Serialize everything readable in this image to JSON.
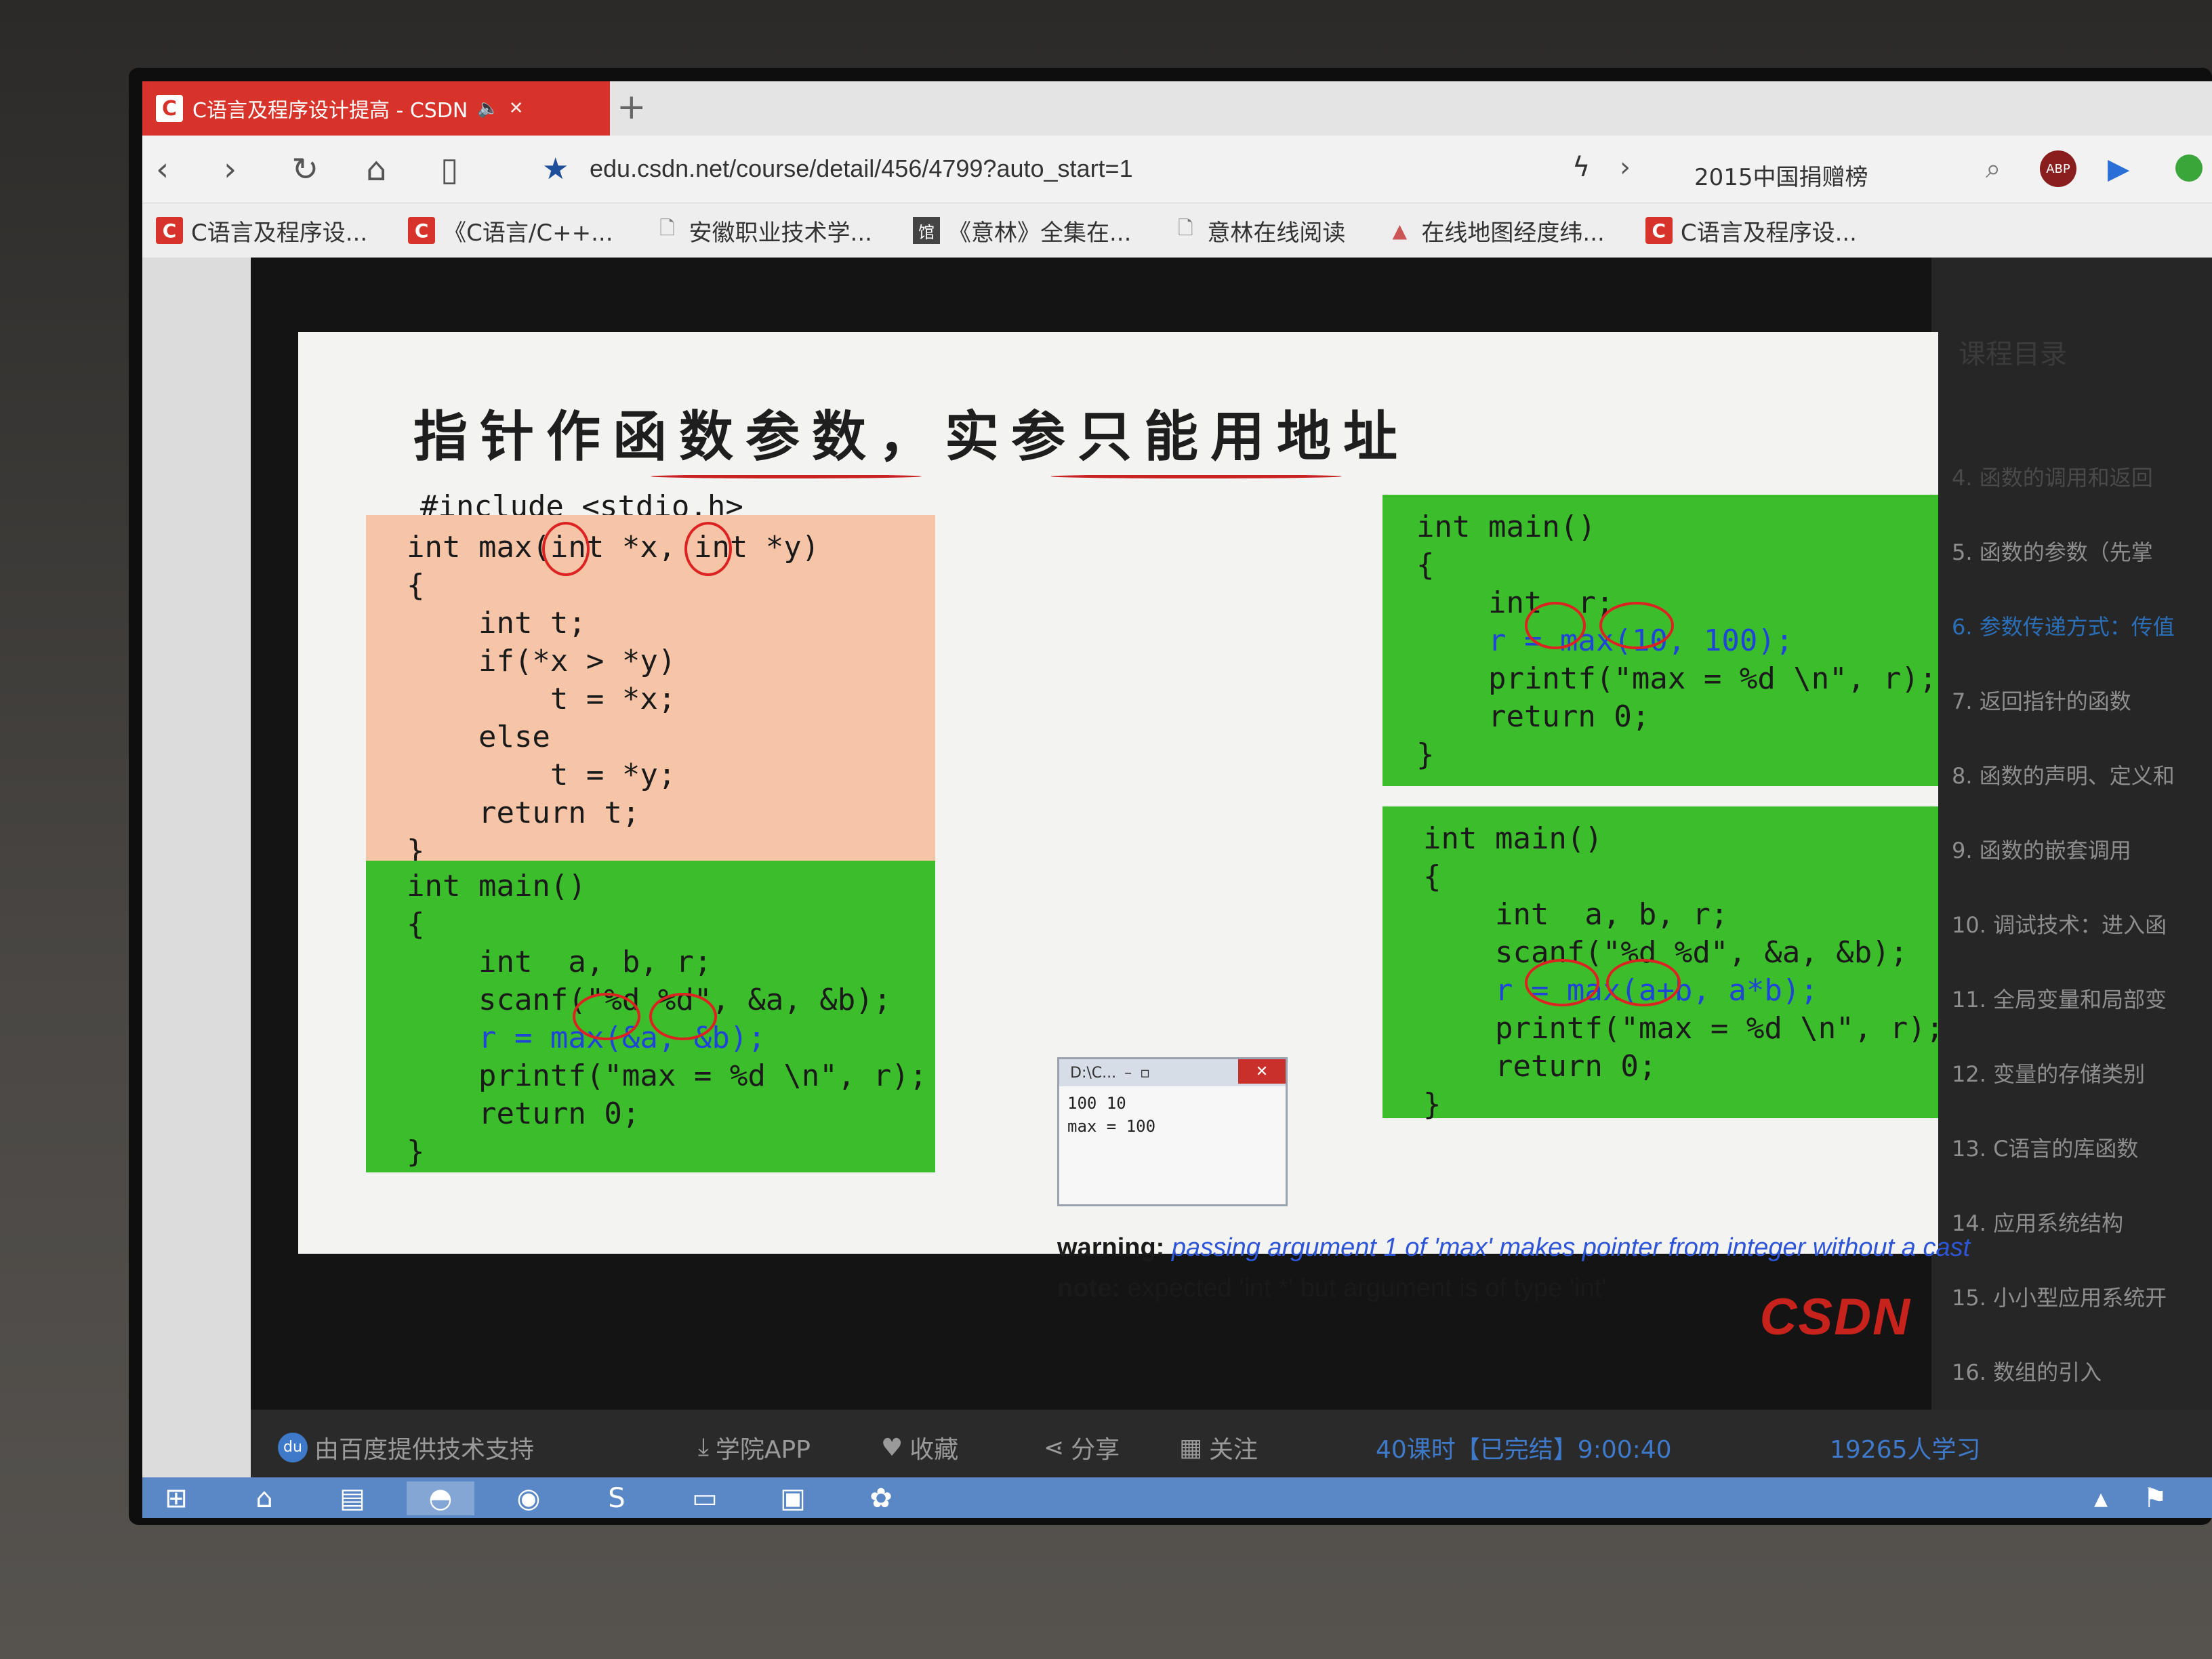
{
  "browser": {
    "tab_title": "C语言及程序设计提高 - CSDN",
    "tab_logo": "C",
    "new_tab": "+",
    "url": "edu.csdn.net/course/detail/456/4799?auto_start=1",
    "search_text": "2015中国捐赠榜",
    "icons": [
      "back-icon",
      "forward-icon",
      "reload-icon",
      "home-icon",
      "reader-icon",
      "star-icon",
      "flash-icon",
      "search-icon",
      "adblock-icon",
      "play-icon"
    ]
  },
  "bookmarks": [
    {
      "label": "C语言及程序设...",
      "icon": "C"
    },
    {
      "label": "《C语言/C++...",
      "icon": "C"
    },
    {
      "label": "安徽职业技术学...",
      "icon": "doc"
    },
    {
      "label": "《意林》全集在...",
      "icon": "馆"
    },
    {
      "label": "意林在线阅读",
      "icon": "doc"
    },
    {
      "label": "在线地图经度纬...",
      "icon": "map"
    },
    {
      "label": "C语言及程序设...",
      "icon": "C"
    }
  ],
  "slide": {
    "title": "指针作函数参数，实参只能用地址",
    "include": "#include <stdio.h>",
    "max_func": "int max(int *x, int *y)\n{\n    int t;\n    if(*x > *y)\n        t = *x;\n    else\n        t = *y;\n    return t;\n}",
    "main1_a": "int main()\n{\n    int  a, b, r;\n    scanf(\"%d %d\", &a, &b);",
    "main1_call": "    r = max(&a, &b);",
    "main1_b": "    printf(\"max = %d \\n\", r);\n    return 0;\n}",
    "main2_a": "int main()\n{\n    int  r;",
    "main2_call": "    r = max(10, 100);",
    "main2_b": "    printf(\"max = %d \\n\", r);\n    return 0;\n}",
    "main3_a": "int main()\n{\n    int  a, b, r;\n    scanf(\"%d %d\", &a, &b);",
    "main3_call": "    r = max(a+b, a*b);",
    "main3_b": "    printf(\"max = %d \\n\", r);\n    return 0;\n}",
    "console_title": "D:\\C...",
    "console_output": "100 10\nmax = 100",
    "warning_label": "warning:",
    "warning_msg": "passing argument 1 of 'max' makes pointer from integer without a cast",
    "note_label": "note:",
    "note_msg": "expected 'int *' but argument is of type 'int'",
    "brand": "CSDN"
  },
  "sidebar": {
    "title": "课程目录",
    "items": [
      "4. 函数的调用和返回",
      "5. 函数的参数（先掌",
      "6. 参数传递方式：传值",
      "7. 返回指针的函数",
      "8. 函数的声明、定义和",
      "9. 函数的嵌套调用",
      "10. 调试技术：进入函",
      "11. 全局变量和局部变",
      "12. 变量的存储类别",
      "13. C语言的库函数",
      "14. 应用系统结构",
      "15. 小小型应用系统开",
      "16. 数组的引入"
    ],
    "active_index": 2
  },
  "controls": {
    "baidu": "由百度提供技术支持",
    "app": "学院APP",
    "fav": "收藏",
    "share": "分享",
    "follow": "关注",
    "lessons": "40课时【已完结】9:00:40",
    "learners": "19265人学习"
  },
  "colors": {
    "tab_red": "#d8332a",
    "code_green": "#3cbd2c",
    "code_orange": "#f6c4a7",
    "call_blue": "#1f45d8",
    "brand_red": "#c8221c",
    "taskbar_blue": "#5a88c6"
  }
}
